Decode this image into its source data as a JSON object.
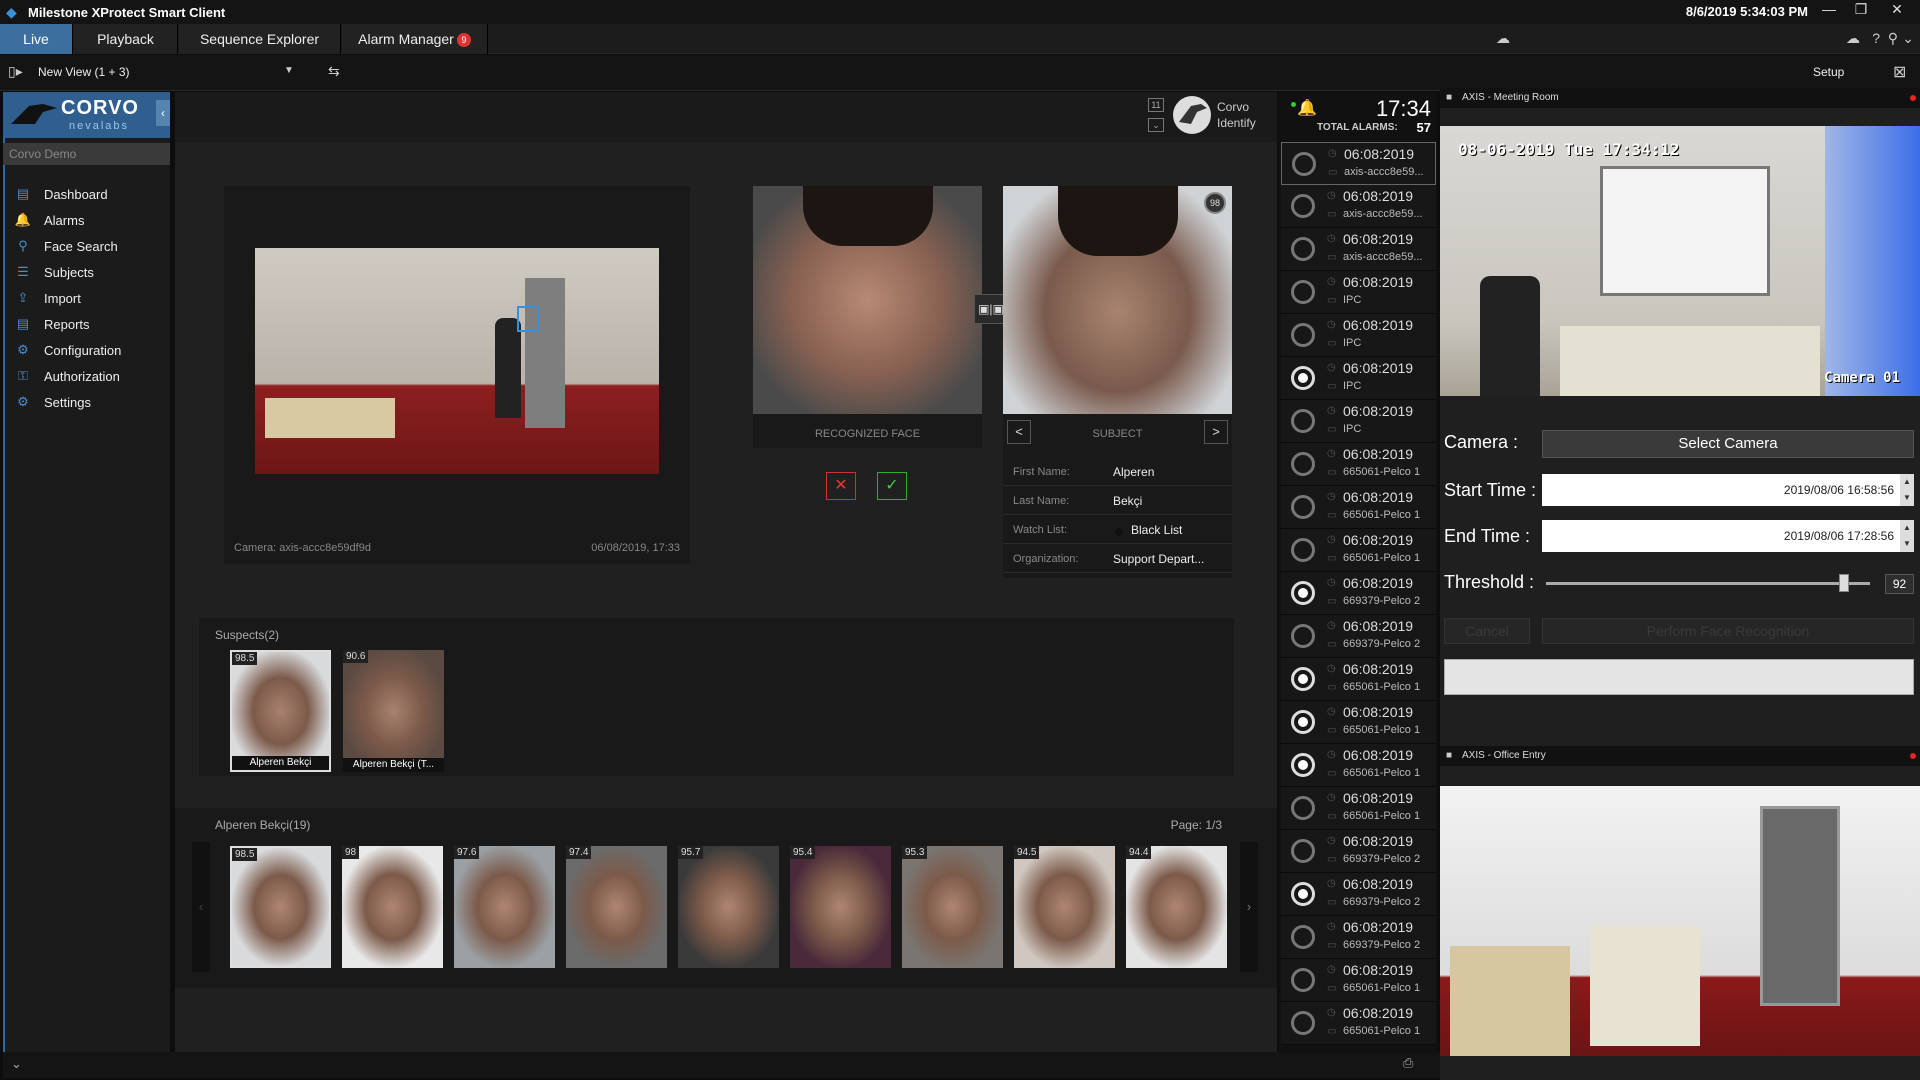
{
  "window": {
    "title": "Milestone XProtect Smart Client",
    "datetime": "8/6/2019 5:34:03 PM"
  },
  "tabs": [
    {
      "label": "Live",
      "active": true
    },
    {
      "label": "Playback"
    },
    {
      "label": "Sequence Explorer"
    },
    {
      "label": "Alarm Manager",
      "badge": "9"
    }
  ],
  "viewbar": {
    "view_name": "New View (1 + 3)",
    "setup_label": "Setup"
  },
  "sidebar": {
    "brand_name": "CORVO",
    "brand_sub": "nevalabs",
    "demo_label": "Corvo Demo",
    "items": [
      {
        "label": "Dashboard",
        "icon": "dashboard-icon"
      },
      {
        "label": "Alarms",
        "icon": "bell-icon"
      },
      {
        "label": "Face Search",
        "icon": "search-icon"
      },
      {
        "label": "Subjects",
        "icon": "subjects-icon"
      },
      {
        "label": "Import",
        "icon": "import-icon"
      },
      {
        "label": "Reports",
        "icon": "reports-icon"
      },
      {
        "label": "Configuration",
        "icon": "gear-icon"
      },
      {
        "label": "Authorization",
        "icon": "key-icon"
      },
      {
        "label": "Settings",
        "icon": "settings-icon"
      }
    ]
  },
  "header": {
    "identify_line1": "Corvo",
    "identify_line2": "Identify",
    "count_badge": "11"
  },
  "detection": {
    "camera": "Camera: axis-accc8e59df9d",
    "timestamp": "06/08/2019, 17:33"
  },
  "recognized_face_label": "RECOGNIZED FACE",
  "subject": {
    "label": "SUBJECT",
    "score": "98",
    "fields": [
      {
        "key": "First Name:",
        "value": "Alperen"
      },
      {
        "key": "Last Name:",
        "value": "Bekçi"
      },
      {
        "key": "Watch List:",
        "value": "Black List"
      },
      {
        "key": "Organization:",
        "value": "Support Depart..."
      }
    ]
  },
  "suspects": {
    "title": "Suspects(2)",
    "items": [
      {
        "score": "98.5",
        "name": "Alperen Bekçi"
      },
      {
        "score": "90.6",
        "name": "Alperen Bekçi (T..."
      }
    ]
  },
  "gallery": {
    "title": "Alperen Bekçi(19)",
    "page": "Page: 1/3",
    "scores": [
      "98.5",
      "98",
      "97.6",
      "97.4",
      "95.7",
      "95.4",
      "95.3",
      "94.5",
      "94.4"
    ]
  },
  "alarms": {
    "time": "17:34",
    "total_label": "TOTAL ALARMS:",
    "total": "57",
    "items": [
      {
        "date": "06:08:2019",
        "cam": "axis-accc8e59...",
        "on": false
      },
      {
        "date": "06:08:2019",
        "cam": "axis-accc8e59...",
        "on": false
      },
      {
        "date": "06:08:2019",
        "cam": "axis-accc8e59...",
        "on": false
      },
      {
        "date": "06:08:2019",
        "cam": "IPC",
        "on": false
      },
      {
        "date": "06:08:2019",
        "cam": "IPC",
        "on": false
      },
      {
        "date": "06:08:2019",
        "cam": "IPC",
        "on": true
      },
      {
        "date": "06:08:2019",
        "cam": "IPC",
        "on": false
      },
      {
        "date": "06:08:2019",
        "cam": "665061-Pelco 1",
        "on": false
      },
      {
        "date": "06:08:2019",
        "cam": "665061-Pelco 1",
        "on": false
      },
      {
        "date": "06:08:2019",
        "cam": "665061-Pelco 1",
        "on": false
      },
      {
        "date": "06:08:2019",
        "cam": "669379-Pelco 2",
        "on": true
      },
      {
        "date": "06:08:2019",
        "cam": "669379-Pelco 2",
        "on": false
      },
      {
        "date": "06:08:2019",
        "cam": "665061-Pelco 1",
        "on": true
      },
      {
        "date": "06:08:2019",
        "cam": "665061-Pelco 1",
        "on": true
      },
      {
        "date": "06:08:2019",
        "cam": "665061-Pelco 1",
        "on": true
      },
      {
        "date": "06:08:2019",
        "cam": "665061-Pelco 1",
        "on": false
      },
      {
        "date": "06:08:2019",
        "cam": "669379-Pelco 2",
        "on": false
      },
      {
        "date": "06:08:2019",
        "cam": "669379-Pelco 2",
        "on": true
      },
      {
        "date": "06:08:2019",
        "cam": "669379-Pelco 2",
        "on": false
      },
      {
        "date": "06:08:2019",
        "cam": "665061-Pelco 1",
        "on": false
      },
      {
        "date": "06:08:2019",
        "cam": "665061-Pelco 1",
        "on": false
      }
    ]
  },
  "camera_top": {
    "title": "AXIS - Meeting Room",
    "osd_datetime": "08-06-2019 Tue 17:34:12",
    "osd_name": "Camera 01"
  },
  "camera_bottom": {
    "title": "AXIS - Office Entry"
  },
  "search_form": {
    "camera_label": "Camera :",
    "select_camera": "Select Camera",
    "start_label": "Start Time :",
    "start_value": "2019/08/06 16:58:56",
    "end_label": "End Time :",
    "end_value": "2019/08/06 17:28:56",
    "threshold_label": "Threshold :",
    "threshold_value": "92",
    "threshold_fraction": 0.92,
    "cancel_label": "Cancel",
    "perform_label": "Perform Face Recognition"
  }
}
